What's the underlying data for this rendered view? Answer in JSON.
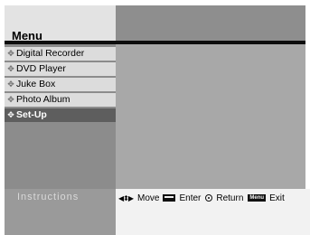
{
  "header": {
    "title": "Menu"
  },
  "sidebar": {
    "items": [
      {
        "label": "Digital Recorder",
        "selected": false
      },
      {
        "label": "DVD Player",
        "selected": false
      },
      {
        "label": "Juke Box",
        "selected": false
      },
      {
        "label": "Photo Album",
        "selected": false
      },
      {
        "label": "Set-Up",
        "selected": true
      }
    ],
    "bullet_icon": "diamond-bullet-icon"
  },
  "footer": {
    "instructions_label": "Instructions",
    "hints": {
      "move": {
        "icon": "arrows-icon",
        "label": "Move"
      },
      "enter": {
        "icon": "enter-key-icon",
        "label": "Enter"
      },
      "return": {
        "icon": "return-key-icon",
        "label": "Return"
      },
      "menu_key": {
        "icon": "menu-key-icon",
        "key_text": "Menu"
      },
      "exit": {
        "label": "Exit"
      }
    }
  },
  "colors": {
    "selected_bg": "#5e5e5e",
    "item_bg": "#dcdcdc",
    "sidebar_bg": "#8c8c8c",
    "content_bg": "#a8a8a8"
  }
}
